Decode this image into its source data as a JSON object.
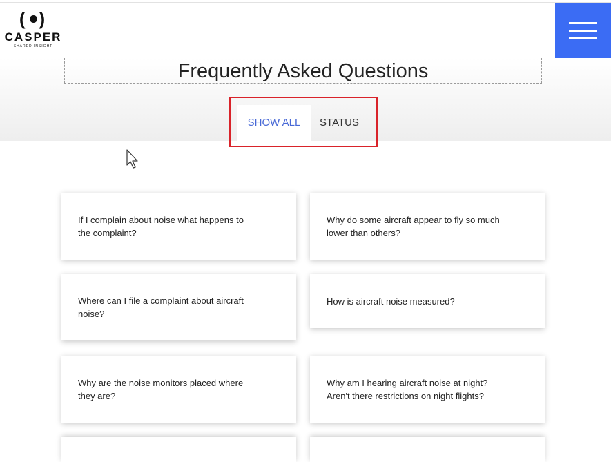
{
  "header": {
    "logo_mark_left": "(",
    "logo_mark_right": ")",
    "logo_name": "CASPER",
    "logo_tagline": "SHARED INSIGHT",
    "menu_icon": "hamburger-icon",
    "accent_color": "#3b6cf4"
  },
  "page": {
    "title": "Frequently Asked Questions"
  },
  "tabs": [
    {
      "label": "SHOW ALL",
      "active": true
    },
    {
      "label": "STATUS",
      "active": false
    }
  ],
  "faq": [
    {
      "question": "If I complain about noise what happens to the complaint?"
    },
    {
      "question": "Why do some aircraft appear to fly so much lower than others?"
    },
    {
      "question": "Where can I file a complaint about aircraft noise?"
    },
    {
      "question": "How is aircraft noise measured?"
    },
    {
      "question": "Why are the noise monitors placed where they are?"
    },
    {
      "question": "Why am I hearing aircraft noise at night? Aren't there restrictions on night flights?"
    }
  ],
  "colors": {
    "active_tab_text": "#4768d6",
    "highlight_border": "#d9232a"
  }
}
